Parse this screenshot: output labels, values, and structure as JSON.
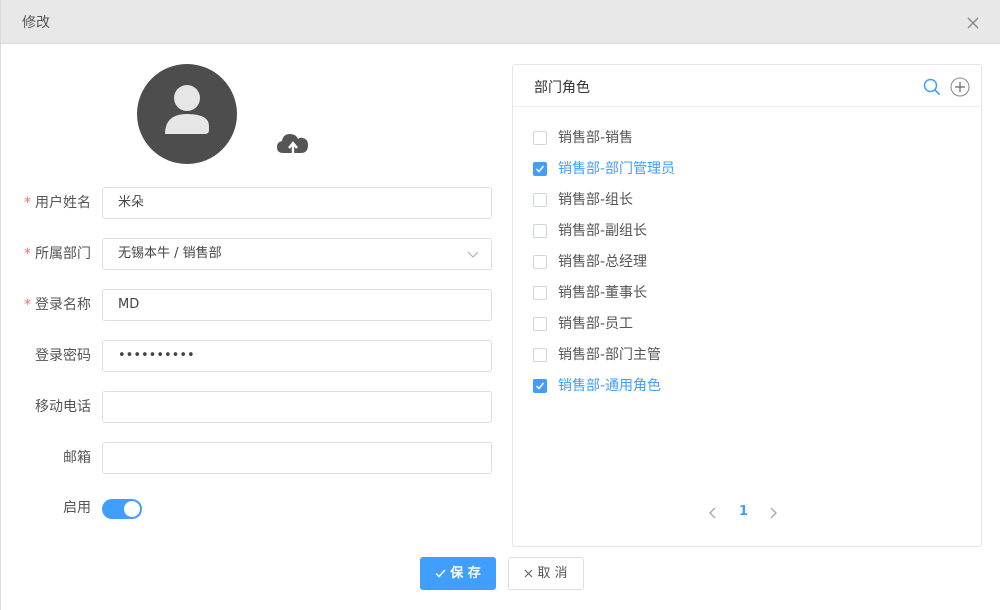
{
  "dialog": {
    "title": "修改"
  },
  "form": {
    "fields": [
      {
        "label": "用户姓名",
        "required": true,
        "value": "米朵",
        "placeholder": ""
      },
      {
        "label": "所属部门",
        "required": true,
        "value": "无锡本牛 / 销售部",
        "placeholder": ""
      },
      {
        "label": "登录名称",
        "required": true,
        "value": "MD",
        "placeholder": ""
      },
      {
        "label": "登录密码",
        "required": false,
        "value": "••••••••••",
        "placeholder": ""
      },
      {
        "label": "移动电话",
        "required": false,
        "value": "",
        "placeholder": ""
      },
      {
        "label": "邮箱",
        "required": false,
        "value": "",
        "placeholder": ""
      }
    ],
    "enable": {
      "label": "启用",
      "on": true
    }
  },
  "roles_panel": {
    "title": "部门角色",
    "roles": [
      {
        "label": "销售部-销售",
        "checked": false
      },
      {
        "label": "销售部-部门管理员",
        "checked": true
      },
      {
        "label": "销售部-组长",
        "checked": false
      },
      {
        "label": "销售部-副组长",
        "checked": false
      },
      {
        "label": "销售部-总经理",
        "checked": false
      },
      {
        "label": "销售部-董事长",
        "checked": false
      },
      {
        "label": "销售部-员工",
        "checked": false
      },
      {
        "label": "销售部-部门主管",
        "checked": false
      },
      {
        "label": "销售部-通用角色",
        "checked": true
      }
    ],
    "pager": {
      "current_page": "1"
    }
  },
  "footer": {
    "save_label": "保 存",
    "cancel_label": "取 消"
  },
  "colors": {
    "primary": "#409eff",
    "required": "#f56c6c",
    "avatar_bg": "#4d4d4d"
  }
}
